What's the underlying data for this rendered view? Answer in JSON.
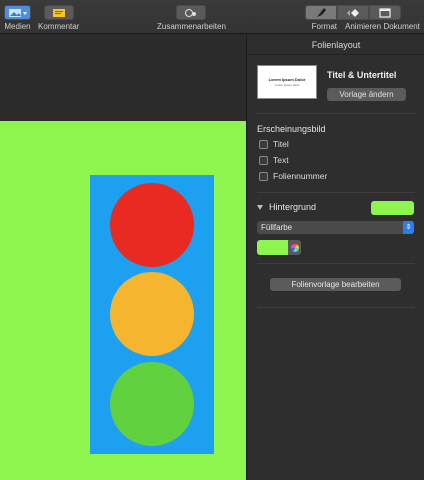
{
  "toolbar": {
    "medien_label": "Medien",
    "kommentar_label": "Kommentar",
    "zusammen_label": "Zusammenarbeiten",
    "format_label": "Format",
    "animieren_label": "Animieren",
    "dokument_label": "Dokument"
  },
  "slide": {
    "background_color": "#8ef44e",
    "box_color": "#1ea0f0",
    "lamps": [
      "#e82a22",
      "#f5b52f",
      "#61d140"
    ]
  },
  "panel": {
    "title": "Folienlayout",
    "thumbnail_title": "Lorem Ipsum Dolor",
    "thumbnail_subtitle": "Lorem ipsum dolor",
    "layout_name": "Titel & Untertitel",
    "change_button": "Vorlage ändern",
    "appearance_title": "Erscheinungsbild",
    "checkboxes": [
      {
        "label": "Titel",
        "checked": false
      },
      {
        "label": "Text",
        "checked": false
      },
      {
        "label": "Foliennummer",
        "checked": false
      }
    ],
    "background_title": "Hintergrund",
    "fill_type": "Füllfarbe",
    "fill_color": "#8ef44e",
    "edit_master_button": "Folienvorlage bearbeiten"
  }
}
